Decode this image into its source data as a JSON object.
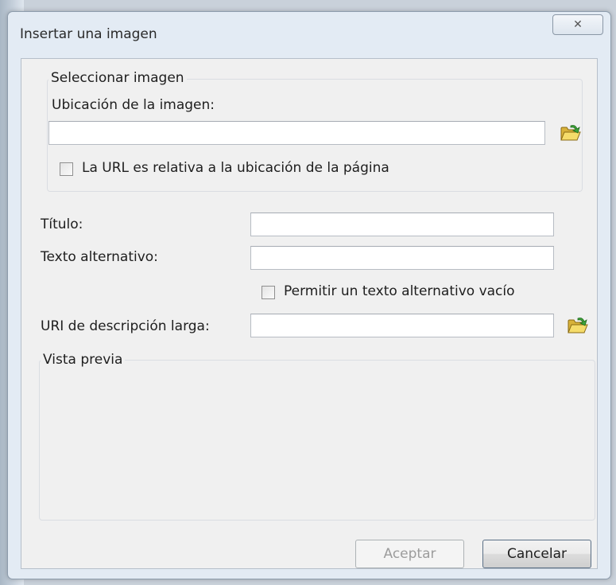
{
  "window": {
    "title": "Insertar una imagen",
    "close_glyph": "✕"
  },
  "select_image": {
    "legend": "Seleccionar imagen",
    "location_label": "Ubicación de la imagen:",
    "location_value": "",
    "relative_url_label": "La URL es relativa a la ubicación de la página",
    "relative_url_checked": false
  },
  "title_field": {
    "label": "Título:",
    "value": ""
  },
  "alt_text": {
    "label": "Texto alternativo:",
    "value": "",
    "allow_empty_label": "Permitir un texto alternativo vacío",
    "allow_empty_checked": false
  },
  "long_desc": {
    "label": "URI de descripción larga:",
    "value": ""
  },
  "preview": {
    "legend": "Vista previa"
  },
  "buttons": {
    "accept": "Aceptar",
    "cancel": "Cancelar"
  },
  "icons": {
    "browse": "folder-open-icon",
    "close": "close-icon"
  }
}
